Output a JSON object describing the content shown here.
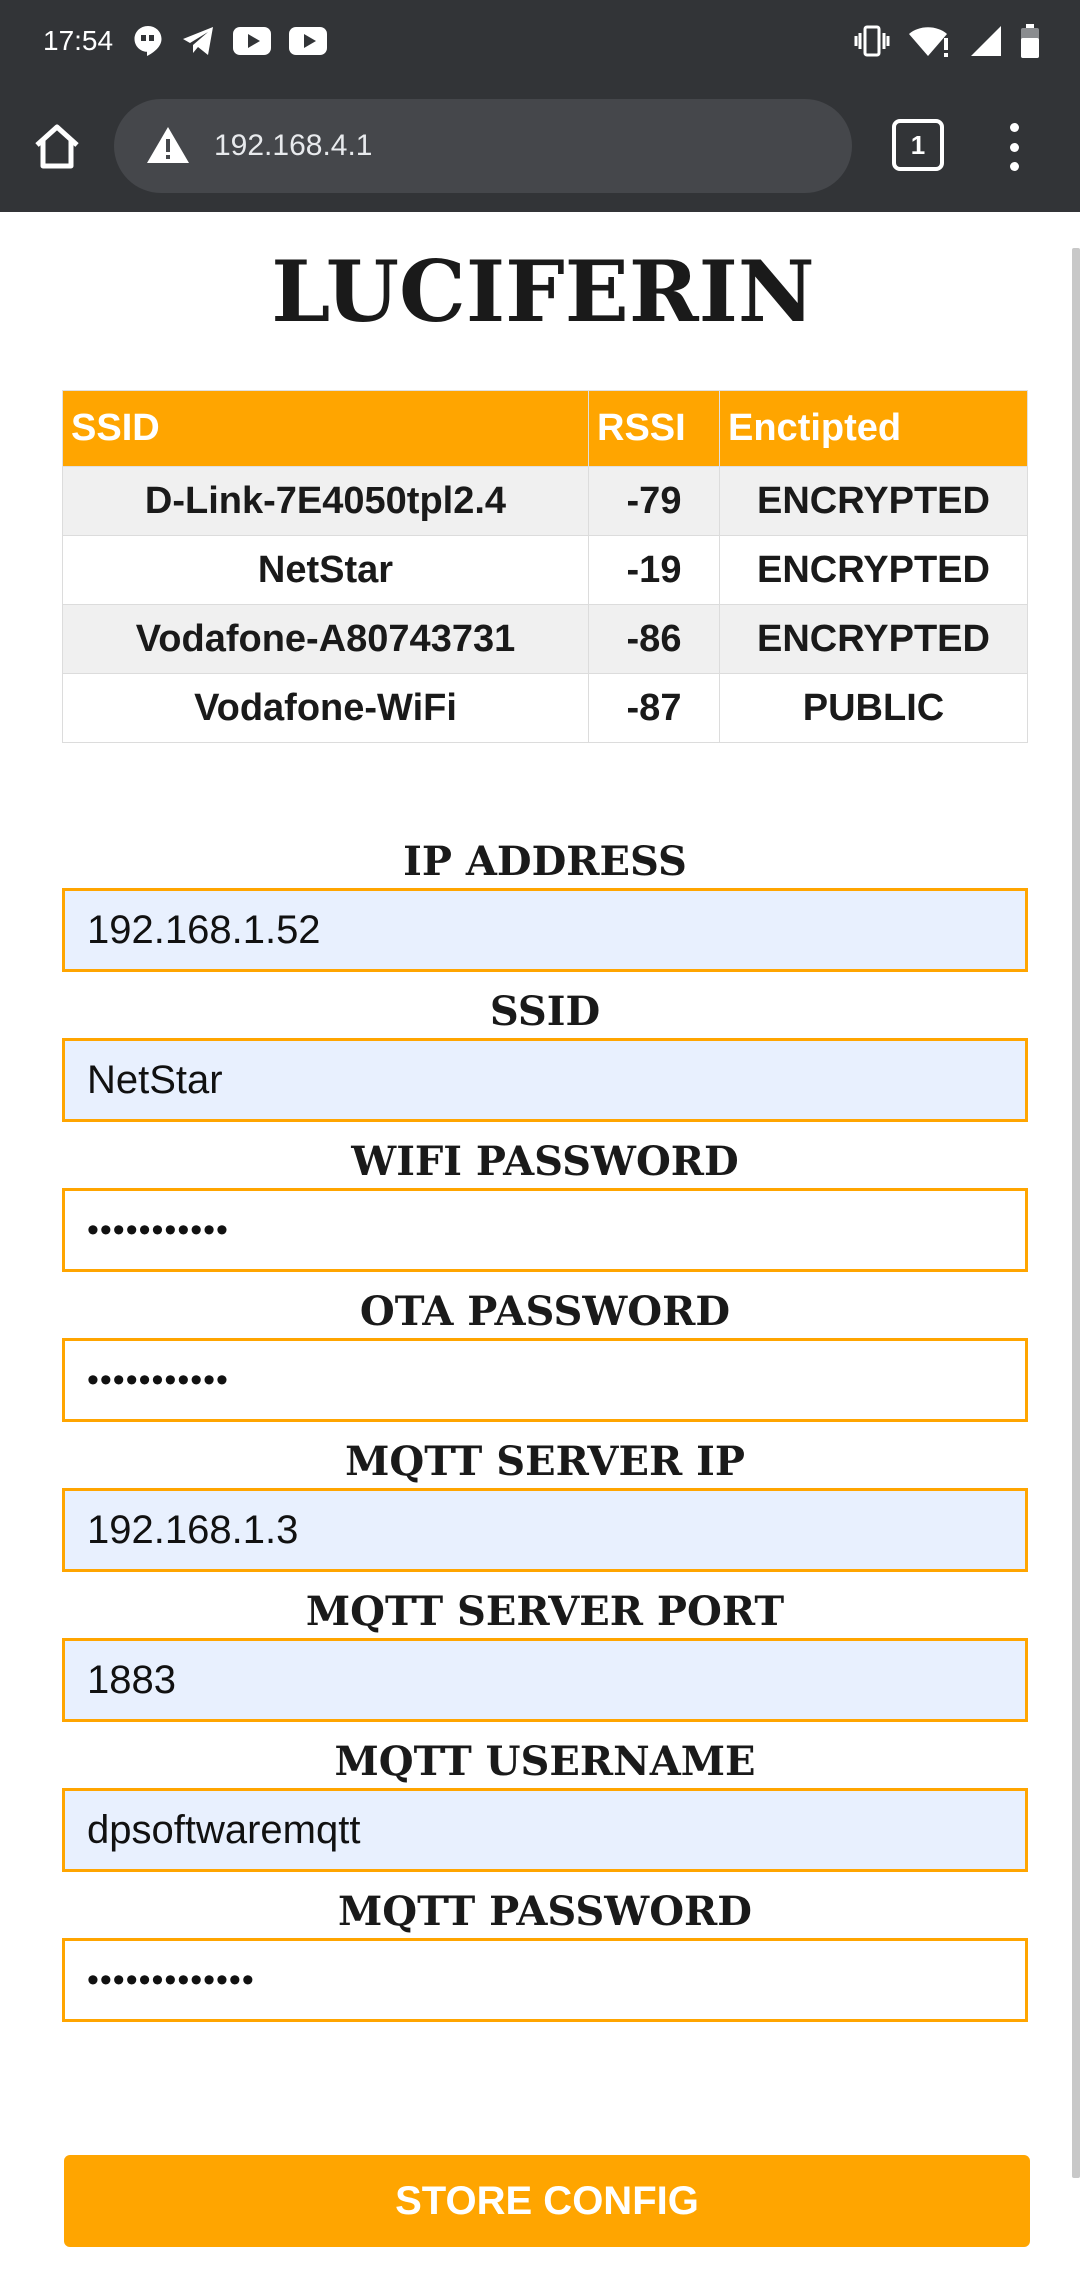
{
  "status_bar": {
    "time": "17:54",
    "notification_icons": [
      "hangouts-icon",
      "telegram-icon",
      "youtube-icon",
      "youtube-icon"
    ],
    "system_icons": [
      "vibrate-icon",
      "wifi-alert-icon",
      "signal-icon",
      "battery-icon"
    ]
  },
  "browser": {
    "url": "192.168.4.1",
    "tab_count": "1",
    "security_icon": "warning-icon"
  },
  "page": {
    "title": "LUCIFERIN",
    "networks_table": {
      "headers": [
        "SSID",
        "RSSI",
        "Enctipted"
      ],
      "rows": [
        [
          "D-Link-7E4050tpl2.4",
          "-79",
          "ENCRYPTED"
        ],
        [
          "NetStar",
          "-19",
          "ENCRYPTED"
        ],
        [
          "Vodafone-A80743731",
          "-86",
          "ENCRYPTED"
        ],
        [
          "Vodafone-WiFi",
          "-87",
          "PUBLIC"
        ]
      ]
    },
    "form": {
      "fields": [
        {
          "label": "IP ADDRESS",
          "value": "192.168.1.52"
        },
        {
          "label": "SSID",
          "value": "NetStar"
        },
        {
          "label": "WIFI PASSWORD",
          "value": "•••••••••••"
        },
        {
          "label": "OTA PASSWORD",
          "value": "•••••••••••"
        },
        {
          "label": "MQTT SERVER IP",
          "value": "192.168.1.3"
        },
        {
          "label": "MQTT SERVER PORT",
          "value": "1883"
        },
        {
          "label": "MQTT USERNAME",
          "value": "dpsoftwaremqtt"
        },
        {
          "label": "MQTT PASSWORD",
          "value": "•••••••••••••"
        }
      ],
      "submit_label": "STORE CONFIG"
    }
  },
  "colors": {
    "accent": "#ffa500",
    "chrome_bar": "#323437",
    "omnibox": "#45474b",
    "autofill_bg": "#e8f0fe"
  }
}
